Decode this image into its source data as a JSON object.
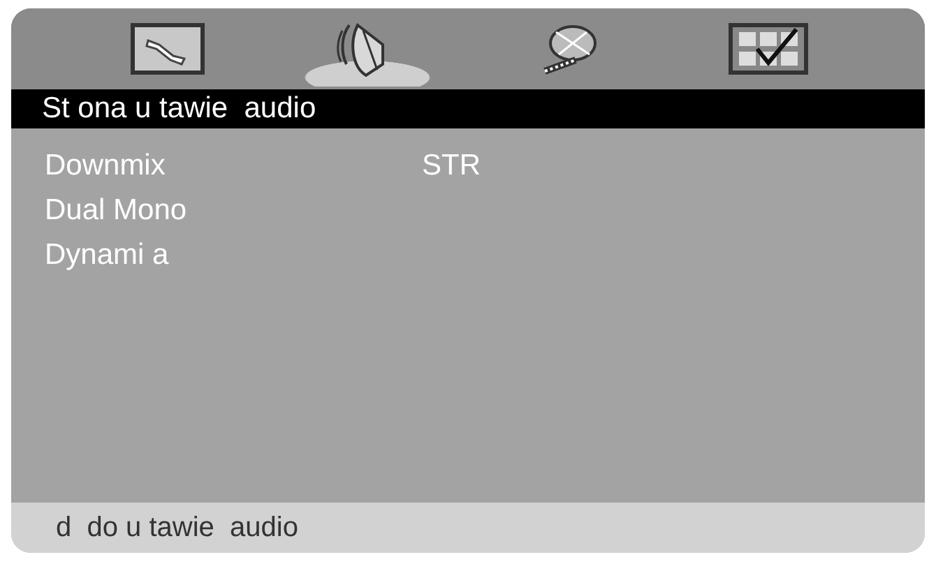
{
  "tabs": [
    {
      "kind": "settings",
      "selected": false
    },
    {
      "kind": "audio",
      "selected": true
    },
    {
      "kind": "disc",
      "selected": false
    },
    {
      "kind": "preferences",
      "selected": false
    }
  ],
  "title": "St ona u tawie  audio",
  "items": [
    {
      "label": "Downmix",
      "value": "STR"
    },
    {
      "label": "Dual Mono"
    },
    {
      "label": "Dynami a"
    }
  ],
  "footer": "d  do u tawie  audio"
}
